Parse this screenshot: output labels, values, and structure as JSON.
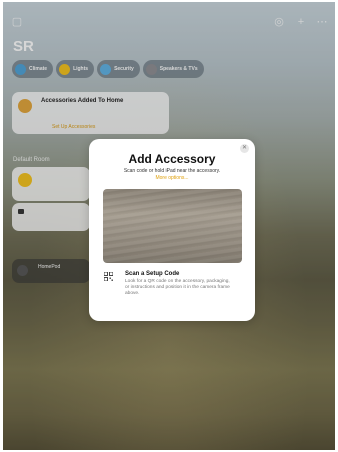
{
  "home": {
    "title": "SR",
    "top_icons": [
      "waveform-icon",
      "plus-icon",
      "more-icon"
    ],
    "chips": [
      {
        "label": "Climate",
        "sub": "",
        "color": "#4da3d8"
      },
      {
        "label": "Lights",
        "sub": "",
        "color": "#f5c21b"
      },
      {
        "label": "Security",
        "sub": "",
        "color": "#5fb3e6"
      },
      {
        "label": "Speakers & TVs",
        "sub": "",
        "color": "#8e8e93"
      }
    ],
    "accessories_card": {
      "title": "Accessories Added To Home",
      "subtitle": "",
      "link": "Set Up Accessories"
    },
    "section_default_room": "Default Room",
    "homepod": {
      "name": "HomePod",
      "status": ""
    }
  },
  "modal": {
    "title": "Add Accessory",
    "subtitle": "Scan code or hold iPad near the accessory.",
    "more_options": "More options...",
    "scan_title": "Scan a Setup Code",
    "scan_text": "Look for a QR code on the accessory, packaging, or instructions and position it in the camera frame above.",
    "close_icon": "xmark-icon",
    "accent": "#e0a20f"
  }
}
